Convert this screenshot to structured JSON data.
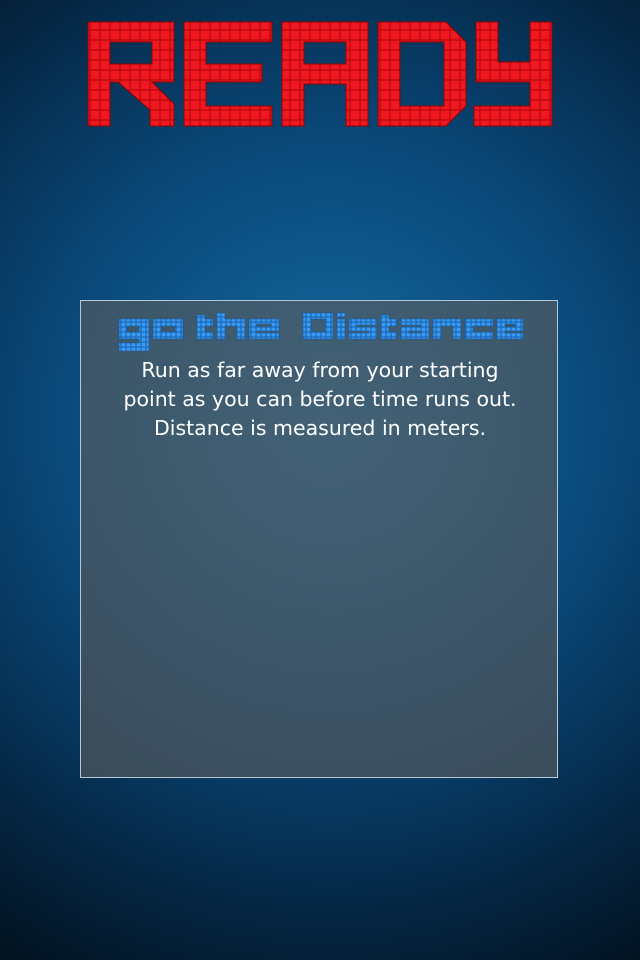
{
  "status_title": "READY",
  "mode": {
    "title": "go the distance",
    "description": "Run as far away from your starting\npoint as you can before time runs out.\nDistance is measured in meters."
  },
  "colors": {
    "status_title": "#e8121a",
    "mode_title": "#2f8fe6",
    "description_text": "#ffffff",
    "panel_border": "#b7c7d4"
  }
}
